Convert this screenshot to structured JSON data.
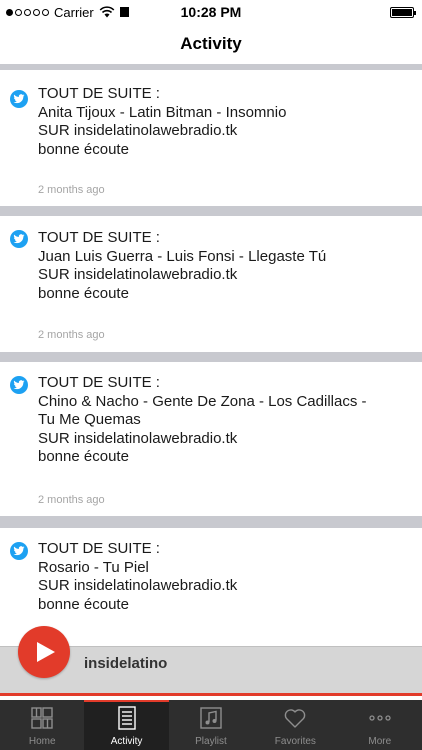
{
  "status_bar": {
    "carrier": "Carrier",
    "time": "10:28 PM"
  },
  "header": {
    "title": "Activity"
  },
  "feed": {
    "items": [
      {
        "text": "TOUT DE SUITE :\nAnita Tijoux - Latin Bitman - Insomnio\nSUR insidelatinolawebradio.tk\nbonne écoute",
        "time_ago": "2 months ago"
      },
      {
        "text": "TOUT DE SUITE :\nJuan Luis Guerra - Luis Fonsi - Llegaste Tú\nSUR insidelatinolawebradio.tk\nbonne écoute",
        "time_ago": "2 months ago"
      },
      {
        "text": "TOUT DE SUITE :\nChino & Nacho - Gente De Zona - Los Cadillacs -\nTu Me Quemas\nSUR insidelatinolawebradio.tk\nbonne écoute",
        "time_ago": "2 months ago"
      },
      {
        "text": "TOUT DE SUITE :\nRosario - Tu Piel\nSUR insidelatinolawebradio.tk\nbonne écoute",
        "time_ago": ""
      }
    ]
  },
  "player": {
    "station_name": "insidelatino",
    "accent_color": "#e23b2a"
  },
  "tabs": [
    {
      "label": "Home",
      "icon": "grid-icon",
      "active": false
    },
    {
      "label": "Activity",
      "icon": "list-icon",
      "active": true
    },
    {
      "label": "Playlist",
      "icon": "music-note-icon",
      "active": false
    },
    {
      "label": "Favorites",
      "icon": "heart-icon",
      "active": false
    },
    {
      "label": "More",
      "icon": "more-dots-icon",
      "active": false
    }
  ]
}
